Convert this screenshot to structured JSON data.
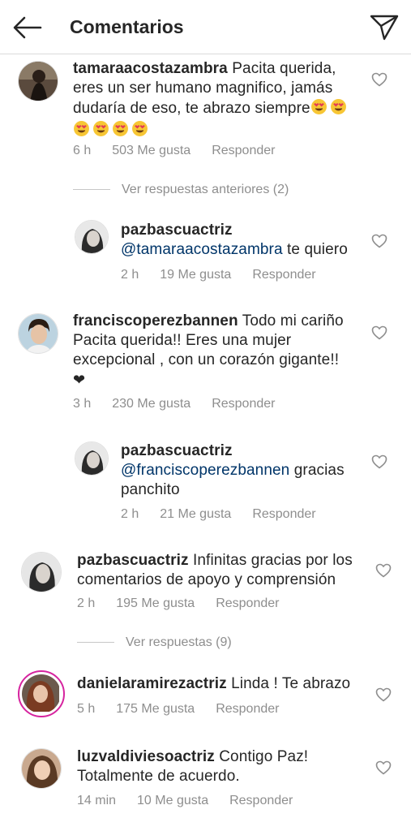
{
  "header": {
    "title": "Comentarios"
  },
  "comments": [
    {
      "user": "tamaraacostazambra",
      "text": "Pacita querida, eres un ser humano magnifico, jamás dudaría de eso, te abrazo siempre",
      "time": "6 h",
      "likes": "503 Me gusta",
      "reply": "Responder"
    }
  ],
  "view_prev_replies": "Ver respuestas anteriores (2)",
  "reply1": {
    "user": "pazbascuactriz",
    "mention": "@tamaraacostazambra",
    "text": "te quiero",
    "time": "2 h",
    "likes": "19 Me gusta",
    "reply": "Responder"
  },
  "comment2": {
    "user": "franciscoperezbannen",
    "text": "Todo mi cariño Pacita querida!! Eres una mujer excepcional , con un corazón gigante!!",
    "heart_emoji": "❤",
    "time": "3 h",
    "likes": "230 Me gusta",
    "reply": "Responder"
  },
  "reply2": {
    "user": "pazbascuactriz",
    "mention": "@franciscoperezbannen",
    "text": "gracias panchito",
    "time": "2 h",
    "likes": "21 Me gusta",
    "reply": "Responder"
  },
  "comment3": {
    "user": "pazbascuactriz",
    "text": "Infinitas gracias por los comentarios de apoyo y comprensión",
    "time": "2 h",
    "likes": "195 Me gusta",
    "reply": "Responder"
  },
  "view_replies": "Ver respuestas (9)",
  "comment4": {
    "user": "danielaramirezactriz",
    "text": "Linda ! Te abrazo",
    "time": "5 h",
    "likes": "175 Me gusta",
    "reply": "Responder"
  },
  "comment5": {
    "user": "luzvaldiviesoactriz",
    "text": "Contigo Paz! Totalmente de acuerdo.",
    "time": "14 min",
    "likes": "10 Me gusta",
    "reply": "Responder"
  },
  "icons": {
    "back": "arrow-left-icon",
    "share": "paper-plane-icon",
    "like": "heart-outline-icon",
    "emoji": "smiling-face-with-heart-eyes"
  },
  "colors": {
    "text": "#262626",
    "secondary": "#8e8e8e",
    "mention": "#003569",
    "story_ring": "#d6249f"
  }
}
